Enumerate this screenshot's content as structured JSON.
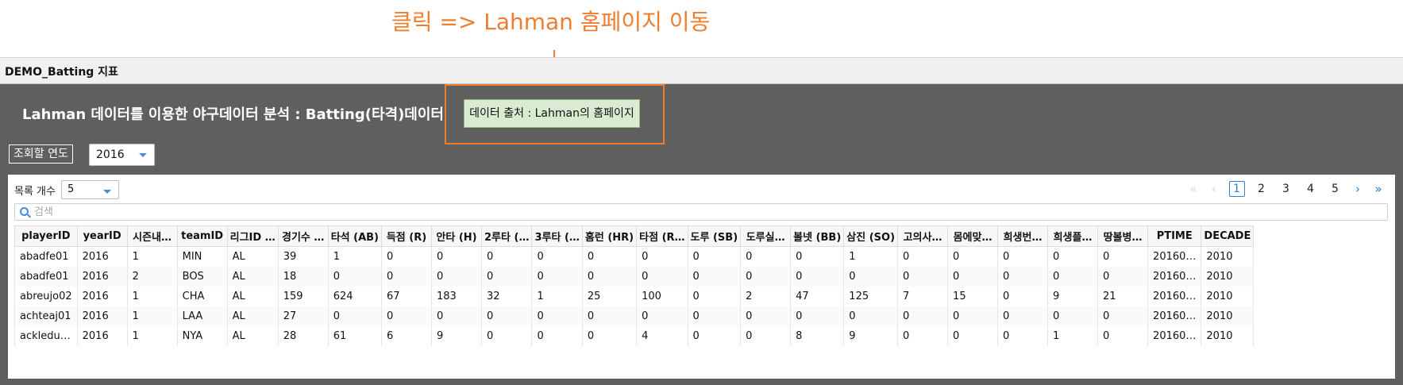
{
  "annotation": {
    "text": "클릭 => Lahman 홈페이지 이동",
    "color": "#ed7d31"
  },
  "window": {
    "title": "DEMO_Batting 지표"
  },
  "header": {
    "title": "Lahman 데이터를 이용한 야구데이터 분석 : Batting(타격)데이터",
    "source_button": "데이터 출처 : Lahman의 홈페이지"
  },
  "filters": {
    "year_label": "조회할 연도",
    "year_value": "2016"
  },
  "grid": {
    "rows_label": "목록 개수",
    "rows_value": "5",
    "search_placeholder": "검색",
    "pager": {
      "pages": [
        "1",
        "2",
        "3",
        "4",
        "5"
      ],
      "current": "1"
    },
    "columns": [
      "playerID",
      "yearID",
      "시즌내…",
      "teamID",
      "리그ID …",
      "경기수 …",
      "타석 (AB)",
      "득점 (R)",
      "안타 (H)",
      "2루타 (…",
      "3루타 (…",
      "홈런 (HR)",
      "타점 (R…",
      "도루 (SB)",
      "도루실…",
      "볼넷 (BB)",
      "삼진 (SO)",
      "고의사…",
      "몸에맞…",
      "희생번…",
      "희생플…",
      "땅볼병…",
      "PTIME",
      "DECADE"
    ],
    "rows": [
      [
        "abadfe01",
        "2016",
        "1",
        "MIN",
        "AL",
        "39",
        "1",
        "0",
        "0",
        "0",
        "0",
        "0",
        "0",
        "0",
        "0",
        "0",
        "1",
        "0",
        "0",
        "0",
        "0",
        "0",
        "20160…",
        "2010"
      ],
      [
        "abadfe01",
        "2016",
        "2",
        "BOS",
        "AL",
        "18",
        "0",
        "0",
        "0",
        "0",
        "0",
        "0",
        "0",
        "0",
        "0",
        "0",
        "0",
        "0",
        "0",
        "0",
        "0",
        "0",
        "20160…",
        "2010"
      ],
      [
        "abreujo02",
        "2016",
        "1",
        "CHA",
        "AL",
        "159",
        "624",
        "67",
        "183",
        "32",
        "1",
        "25",
        "100",
        "0",
        "2",
        "47",
        "125",
        "7",
        "15",
        "0",
        "9",
        "21",
        "20160…",
        "2010"
      ],
      [
        "achteaj01",
        "2016",
        "1",
        "LAA",
        "AL",
        "27",
        "0",
        "0",
        "0",
        "0",
        "0",
        "0",
        "0",
        "0",
        "0",
        "0",
        "0",
        "0",
        "0",
        "0",
        "0",
        "0",
        "20160…",
        "2010"
      ],
      [
        "ackledu…",
        "2016",
        "1",
        "NYA",
        "AL",
        "28",
        "61",
        "6",
        "9",
        "0",
        "0",
        "0",
        "4",
        "0",
        "0",
        "8",
        "9",
        "0",
        "0",
        "0",
        "1",
        "0",
        "20160…",
        "2010"
      ]
    ]
  }
}
